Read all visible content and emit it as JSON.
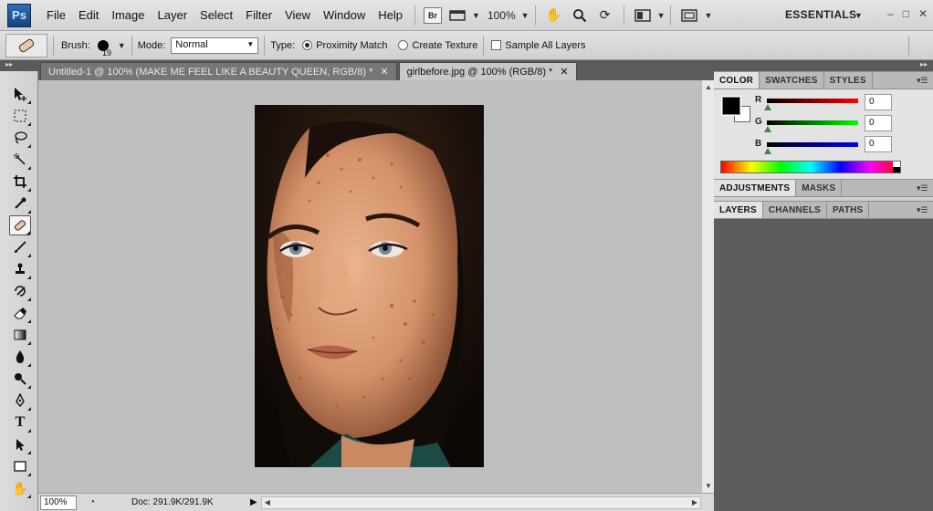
{
  "menubar": {
    "logo": "Ps",
    "items": [
      "File",
      "Edit",
      "Image",
      "Layer",
      "Select",
      "Filter",
      "View",
      "Window",
      "Help"
    ],
    "bridge_label": "Br",
    "zoom": "100%",
    "workspace": "ESSENTIALS",
    "window_controls": [
      "–",
      "□",
      "✕"
    ]
  },
  "options": {
    "brush_label": "Brush:",
    "brush_size": "19",
    "mode_label": "Mode:",
    "mode_value": "Normal",
    "type_label": "Type:",
    "type_option_1": "Proximity Match",
    "type_option_2": "Create Texture",
    "sample_all_layers": "Sample All Layers"
  },
  "tabs": [
    {
      "label": "Untitled-1 @ 100% (MAKE ME FEEL LIKE  A BEAUTY QUEEN, RGB/8) *",
      "close": "✕"
    },
    {
      "label": "girlbefore.jpg @ 100% (RGB/8) *",
      "close": "✕"
    }
  ],
  "status": {
    "zoom": "100%",
    "doc": "Doc: 291.9K/291.9K"
  },
  "color_panel": {
    "tabs": [
      "COLOR",
      "SWATCHES",
      "STYLES"
    ],
    "r_label": "R",
    "r_value": "0",
    "g_label": "G",
    "g_value": "0",
    "b_label": "B",
    "b_value": "0",
    "foreground": "#000000",
    "background": "#ffffff"
  },
  "adjustments_panel": {
    "tabs": [
      "ADJUSTMENTS",
      "MASKS"
    ]
  },
  "layers_panel": {
    "tabs": [
      "LAYERS",
      "CHANNELS",
      "PATHS"
    ]
  },
  "tools": [
    "move-tool-icon",
    "marquee-tool-icon",
    "lasso-tool-icon",
    "quick-select-tool-icon",
    "crop-tool-icon",
    "eyedropper-tool-icon",
    "spot-healing-brush-icon",
    "brush-tool-icon",
    "clone-stamp-icon",
    "history-brush-icon",
    "eraser-tool-icon",
    "gradient-tool-icon",
    "blur-tool-icon",
    "dodge-tool-icon",
    "pen-tool-icon",
    "type-tool-icon",
    "path-select-tool-icon",
    "shape-tool-icon",
    "hand-tool-icon"
  ]
}
